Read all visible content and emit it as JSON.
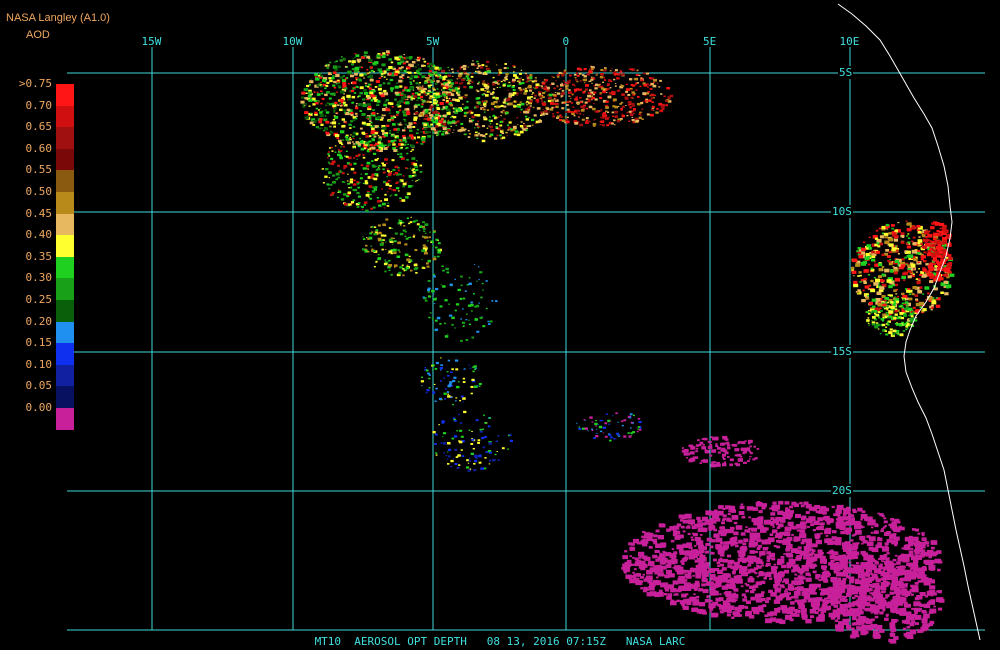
{
  "header": {
    "source": "NASA Langley (A1.0)",
    "units": "AOD"
  },
  "legend": {
    "labels": [
      ">0.75",
      "0.70",
      "0.65",
      "0.60",
      "0.55",
      "0.50",
      "0.45",
      "0.40",
      "0.35",
      "0.30",
      "0.25",
      "0.20",
      "0.15",
      "0.10",
      "0.05",
      "0.00"
    ],
    "colors": [
      "#ff1515",
      "#d01010",
      "#a01010",
      "#7a0808",
      "#8a5a10",
      "#b88a1a",
      "#e8b860",
      "#ffff30",
      "#20d020",
      "#18a018",
      "#0a600a",
      "#2090f0",
      "#1030f0",
      "#1020a0",
      "#081060",
      "#c8209a"
    ]
  },
  "grid": {
    "longitude_labels": [
      "15W",
      "10W",
      "5W",
      "0",
      "5E",
      "10E"
    ],
    "latitude_labels": [
      "5S",
      "10S",
      "15S",
      "20S"
    ],
    "line_color": "#40d8d8"
  },
  "footer": {
    "text": "MT10  AEROSOL OPT DEPTH   08 13, 2016 07:15Z   NASA LARC"
  },
  "colors": {
    "background": "#000000",
    "coast": "#ffffff",
    "text": "#f0a860"
  }
}
